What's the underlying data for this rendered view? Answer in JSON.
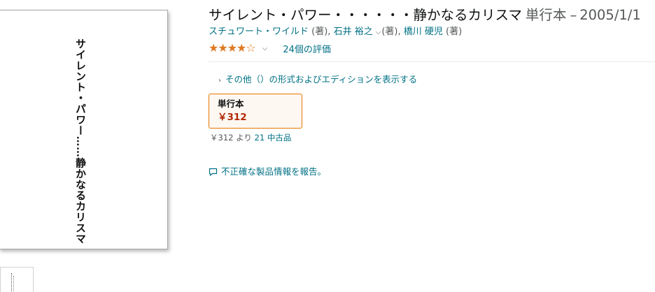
{
  "cover": {
    "title_text": "サイレント・パワー……静かなるカリスマ"
  },
  "product": {
    "title": "サイレント・パワー・・・・・・静かなるカリスマ",
    "binding": "単行本",
    "dash": "–",
    "date": "2005/1/1"
  },
  "byline": {
    "author1": "スチュワート・ワイルド",
    "role1": "(著),",
    "author2": "石井 裕之",
    "role2": "(著),",
    "author3": "橋川 硬児",
    "role3": "(著)"
  },
  "rating": {
    "stars": "★★★★☆",
    "value": 4,
    "count": "24個の評価"
  },
  "formats": {
    "other_link": "その他（）の形式およびエディションを表示する",
    "selected": {
      "name": "単行本",
      "price": "￥312"
    },
    "used": {
      "prefix": "￥312 より",
      "link": "21 中古品"
    }
  },
  "report": {
    "label": "不正確な製品情報を報告。"
  },
  "colors": {
    "link": "#007185",
    "price": "#b12704",
    "star": "#de7921",
    "selected_border": "#e77600"
  }
}
